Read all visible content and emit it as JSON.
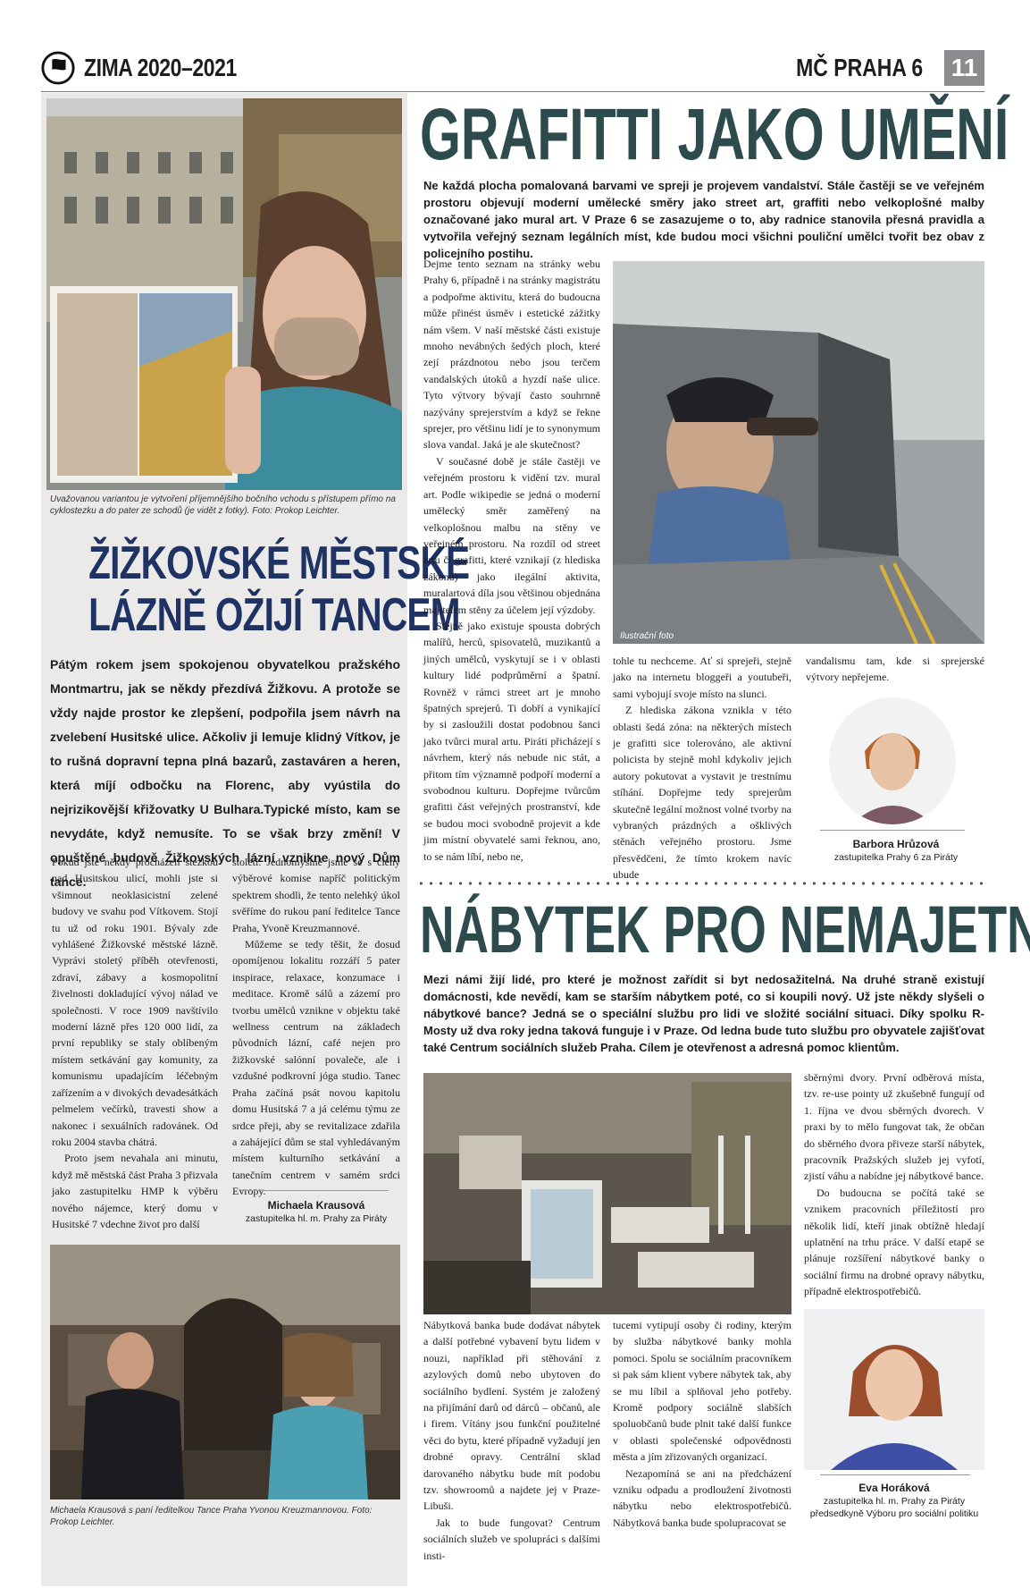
{
  "header": {
    "issue": "ZIMA 2020–2021",
    "district": "MČ PRAHA 6",
    "page_number": "11",
    "logo_icon": "pirate-flag-icon"
  },
  "left_article": {
    "photo_caption": "Uvažovanou variantou je vytvoření příjemnějšího bočního vchodu s přístupem přímo na cyklostezku a do pater ze schodů (je vidět z fotky). Foto: Prokop Leichter.",
    "headline_line1": "ŽIŽKOVSKÉ MĚSTSKÉ",
    "headline_line2": "LÁZNĚ OŽIJÍ TANCEM",
    "lead": "Pátým rokem jsem spokojenou obyvatelkou pražského Montmartru, jak se někdy přezdívá Žižkovu. A protože se vždy najde prostor ke zlepšení, podpořila jsem návrh na zvelebení Husitské ulice. Ačkoliv ji lemuje klidný Vítkov, je to rušná dopravní tepna plná bazarů, zastaváren a heren, která míjí odbočku na Florenc, aby vyústila do nejrizikovější křižovatky U Bulhara.Typické místo, kam se nevydáte, když nemusíte. To se však brzy změní! V opuštěné budově Žižkovských lázní vznikne nový Dům tance.",
    "col1": [
      "Pokud jste někdy procházeli stezkou nad Husitskou ulicí, mohli jste si všimnout neoklasicistní zelené budovy ve svahu pod Vítkovem. Stojí tu už od roku 1901. Bývaly zde vyhlášené Žižkovské městské lázně. Vyprávi stoletý příběh otevřenosti, zdraví, zábavy a kosmopolitní živelnosti dokladující vývoj nálad ve společnosti. V roce 1909 navštívilo moderní lázně přes 120 000 lidí, za první republiky se staly oblíbeným místem setkávání gay komunity, za komunismu upadajícím léčebným zařízením a v divokých devadesátkách pelmelem večírků, travesti show a nakonec i sexuálních radovánek. Od roku 2004 stavba chátrá.",
      "Proto jsem nevahala ani minutu, když mě městská část Praha 3 přizvala jako zastupitelku HMP k výběru nového nájemce, který domu v Husitské 7 vdechne život pro další"
    ],
    "col2": [
      "století. Jednomyslně jsme se s členy výběrové komise napříč politickým spektrem shodli, že tento nelehký úkol svěříme do rukou paní ředitelce Tance Praha, Yvoně Kreuzmannové.",
      "Můžeme se tedy těšit, že dosud opomíjenou lokalitu rozzáří 5 pater inspirace, relaxace, konzumace i meditace. Kromě sálů a zázemí pro tvorbu umělců vznikne v objektu také wellness centrum na základech původních lázní, café nejen pro žižkovské salónní povaleče, ale i vzdušné podkrovní jóga studio. Tanec Praha začíná psát novou kapitolu domu Husitská 7 a já celému týmu ze srdce přeji, aby se revitalizace zdařila a zahájející dům se stal vyhledávaným místem kulturního setkávání a tanečním centrem v samém srdci Evropy."
    ],
    "author_name": "Michaela Krausová",
    "author_role": "zastupitelka hl. m. Prahy za Piráty",
    "bottom_caption": "Michaela Krausová s paní ředitelkou Tance Praha Yvonou Kreuzmannovou. Foto: Prokop Leichter."
  },
  "graffiti_article": {
    "headline": "GRAFITTI JAKO UMĚNÍ",
    "lead": "Ne každá plocha pomalovaná barvami ve spreji je projevem vandalství. Stále častěji se ve veřejném prostoru objevují moderní umělecké směry jako street art, graffiti nebo velkoplošné malby označované jako mural art. V Praze 6 se zasazujeme o to, aby radnice stanovila přesná pravidla a vytvořila veřejný seznam legálních míst, kde budou moci všichni pouliční umělci tvořit bez obav z policejního postihu.",
    "col1": [
      "Dejme tento seznam na stránky webu Prahy 6, případně i na stránky magistrátu a podpořme aktivitu, která do budoucna může přinést úsměv i estetické zážitky nám všem. V naší městské části existuje mnoho nevábných šedých ploch, které zejí prázdnotou nebo jsou terčem vandalských útoků a hyzdí naše ulice. Tyto výtvory bývají často souhrnně nazývány sprejerstvím a když se řekne sprejer, pro většinu lidí je to synonymum slova vandal. Jaká je ale skutečnost?",
      "V současné době je stále častěji ve veřejném prostoru k vidění tzv. mural art. Podle wikipedie se jedná o moderní umělecký směr zaměřený na velkoplošnou malbu na stěny ve veřejném prostoru. Na rozdíl od street artu či grafitti, které vznikají (z hlediska zákonů) jako ilegální aktivita, muralartová díla jsou většinou objednána majitelem stěny za účelem její výzdoby.",
      "Stejně jako existuje spousta dobrých malířů, herců, spisovatelů, muzikantů a jiných umělců, vyskytují se i v oblasti kultury lidé podprůměrní a špatní. Rovněž v rámci street art je mnoho špatných sprejerů. Ti dobří a vynikající by si zasloužili dostat podobnou šanci jako tvůrci mural artu. Piráti přicházejí s návrhem, který nás nebude nic stát, a přitom tím významně podpoří moderní a svobodnou kulturu. Dopřejme tvůrcům grafitti část veřejných prostranství, kde se budou moci svobodně projevit a kde jim místní obyvatelé sami řeknou, ano, to se nám líbí, nebo ne,"
    ],
    "photo_caption": "Ilustrační foto",
    "col2": [
      "tohle tu nechceme. Ať si sprejeři, stejně jako na internetu bloggeři a youtubeři, sami vybojují svoje místo na slunci.",
      "Z hlediska zákona vznikla v této oblasti šedá zóna: na některých místech je grafitti sice tolerováno, ale aktivní policista by stejně mohl kdykoliv jejich autory pokutovat a vystavit je trestnímu stíhání. Dopřejme tedy sprejerům skutečně legální možnost volné tvorby na vybraných prázdných a ošklivých stěnách veřejného prostoru. Jsme přesvědčeni, že tímto krokem navíc ubude"
    ],
    "col3": "vandalismu tam, kde si sprejerské výtvory nepřejeme.",
    "author_name": "Barbora Hrůzová",
    "author_role": "zastupitelka Prahy 6 za Piráty"
  },
  "furniture_article": {
    "headline": "NÁBYTEK PRO NEMAJETNÉ",
    "lead": "Mezi námi žijí lidé, pro které je možnost zařídit si byt nedosažitelná. Na druhé straně existují domácnosti, kde nevědí, kam se starším nábytkem poté, co si koupili nový. Už jste někdy slyšeli o nábytkové bance? Jedná se o speciální službu pro lidi ve složité sociální situaci. Díky spolku R-Mosty už dva roky jedna taková funguje i v Praze. Od ledna bude tuto službu pro obyvatele zajišťovat také Centrum sociálních služeb Praha. Cílem je otevřenost a adresná pomoc klientům.",
    "col3_top": [
      "sběrnými dvory. První odběrová místa, tzv. re-use pointy už zkušebně fungují od 1. října ve dvou sběrných dvorech. V praxi by to mělo fungovat tak, že občan do sběrného dvora přiveze starší nábytek, pracovník Pražských služeb jej vyfotí, zjistí váhu a nabídne jej nábytkové bance.",
      "Do budoucna se počítá také se vznikem pracovních příležitostí pro několik lidí, kteří jinak obtížně hledají uplatnění na trhu práce. V další etapě se plánuje rozšíření nábytkové banky o sociální firmu na drobné opravy nábytku, případně elektrospotřebičů."
    ],
    "col1": [
      "Nábytková banka bude dodávat nábytek a další potřebné vybavení bytu lidem v nouzi, například při stěhování z azylových domů nebo ubytoven do sociálního bydlení. Systém je založený na přijímání darů od dárců – občanů, ale i firem. Vítány jsou funkční použitelné věci do bytu, které případně vyžadují jen drobné opravy. Centrální sklad darovaného nábytku bude mít podobu tzv. showroomů a najdete jej v Praze-Libuši.",
      "Jak to bude fungovat? Centrum sociálních služeb ve spolupráci s dalšími insti-"
    ],
    "col2": [
      "tucemi vytipují osoby či rodiny, kterým by služba nábytkové banky mohla pomoci. Spolu se sociálním pracovníkem si pak sám klient vybere nábytek tak, aby se mu líbil a splňoval jeho potřeby. Kromě podpory sociálně slabších spoluobčanů bude plnit také další funkce v oblasti společenské odpovědnosti města a jím zřizovaných organizací.",
      "Nezapomíná se ani na předcházení vzniku odpadu a prodloužení životnosti nábytku nebo elektrospotřebičů. Nábytková banka bude spolupracovat se"
    ],
    "author_name": "Eva Horáková",
    "author_role": "zastupitelka hl. m. Prahy za Piráty",
    "author_role2": "předsedkyně Výboru pro sociální politiku"
  },
  "colors": {
    "left_headline": "#1f3264",
    "right_headline": "#2d4a4d",
    "left_column_bg": "#eceae8",
    "page_badge": "#8a8c8e"
  }
}
